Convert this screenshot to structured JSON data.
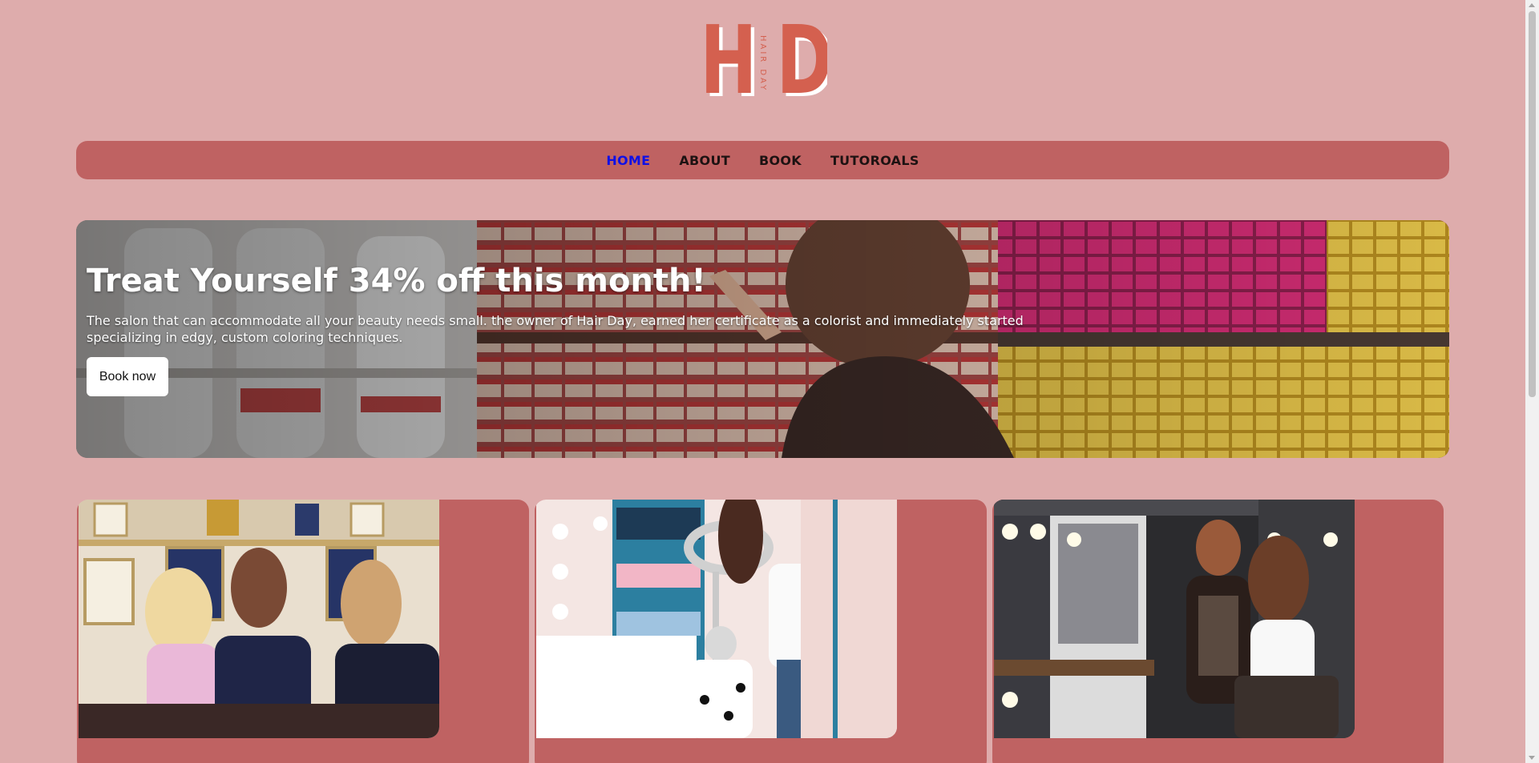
{
  "logo": {
    "letter_left": "H",
    "letter_right": "D",
    "tagline": "HAIR DAY"
  },
  "nav": {
    "items": [
      {
        "label": "HOME",
        "active": true
      },
      {
        "label": "ABOUT",
        "active": false
      },
      {
        "label": "BOOK",
        "active": false
      },
      {
        "label": "TUTOROALS",
        "active": false
      }
    ]
  },
  "hero": {
    "title": "Treat Yourself 34% off this month!",
    "description": "The salon that can accommodate all your beauty needs small. the owner of Hair Day, earned her certificate as a colorist and immediately started specializing in edgy, custom coloring techniques.",
    "button_label": "Book now"
  },
  "colors": {
    "page_bg": "#deacac",
    "accent": "#bf6262",
    "logo_red": "#d4604f",
    "nav_active": "#1010e6"
  },
  "cards": [
    {
      "image": "salon-staff-photo"
    },
    {
      "image": "hair-coloring-photo"
    },
    {
      "image": "hair-consultation-photo"
    }
  ]
}
